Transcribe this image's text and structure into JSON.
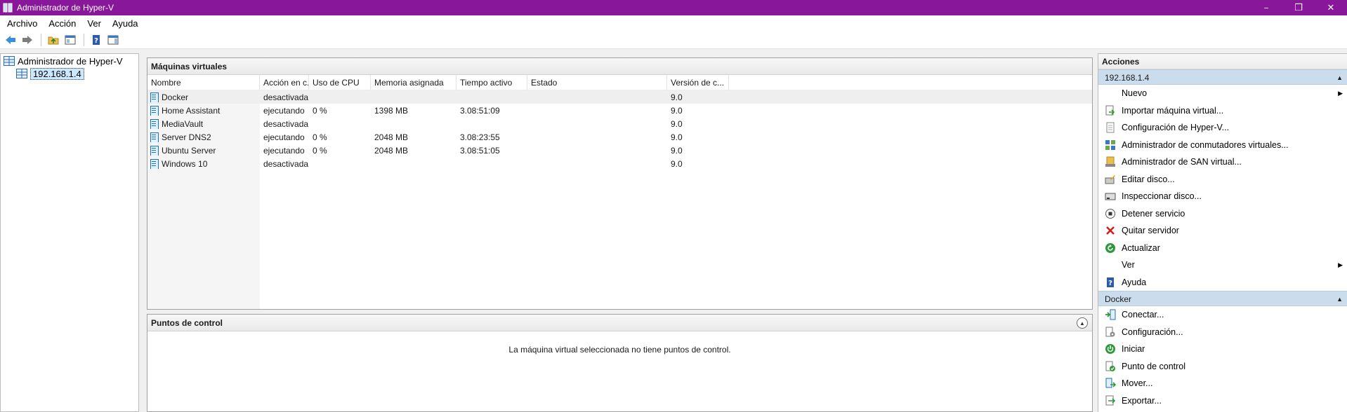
{
  "window": {
    "title": "Administrador de Hyper-V"
  },
  "menu": [
    "Archivo",
    "Acción",
    "Ver",
    "Ayuda"
  ],
  "tree": {
    "root": "Administrador de Hyper-V",
    "server": "192.168.1.4"
  },
  "vm_panel": {
    "title": "Máquinas virtuales",
    "columns": [
      "Nombre",
      "Acción en c...",
      "Uso de CPU",
      "Memoria asignada",
      "Tiempo activo",
      "Estado",
      "Versión de c..."
    ],
    "rows": [
      {
        "name": "Docker",
        "state": "desactivada",
        "cpu": "",
        "memory": "",
        "uptime": "",
        "status": "",
        "version": "9.0"
      },
      {
        "name": "Home Assistant",
        "state": "ejecutando",
        "cpu": "0 %",
        "memory": "1398 MB",
        "uptime": "3.08:51:09",
        "status": "",
        "version": "9.0"
      },
      {
        "name": "MediaVault",
        "state": "desactivada",
        "cpu": "",
        "memory": "",
        "uptime": "",
        "status": "",
        "version": "9.0"
      },
      {
        "name": "Server DNS2",
        "state": "ejecutando",
        "cpu": "0 %",
        "memory": "2048 MB",
        "uptime": "3.08:23:55",
        "status": "",
        "version": "9.0"
      },
      {
        "name": "Ubuntu Server",
        "state": "ejecutando",
        "cpu": "0 %",
        "memory": "2048 MB",
        "uptime": "3.08:51:05",
        "status": "",
        "version": "9.0"
      },
      {
        "name": "Windows 10",
        "state": "desactivada",
        "cpu": "",
        "memory": "",
        "uptime": "",
        "status": "",
        "version": "9.0"
      }
    ]
  },
  "checkpoints": {
    "title": "Puntos de control",
    "empty_message": "La máquina virtual seleccionada no tiene puntos de control."
  },
  "actions": {
    "title": "Acciones",
    "server_group": "192.168.1.4",
    "server_items": [
      {
        "label": "Nuevo",
        "icon": "none",
        "submenu": true
      },
      {
        "label": "Importar máquina virtual...",
        "icon": "import-vm-icon"
      },
      {
        "label": "Configuración de Hyper-V...",
        "icon": "settings-page-icon"
      },
      {
        "label": "Administrador de conmutadores virtuales...",
        "icon": "switch-manager-icon"
      },
      {
        "label": "Administrador de SAN virtual...",
        "icon": "san-icon"
      },
      {
        "label": "Editar disco...",
        "icon": "edit-disk-icon"
      },
      {
        "label": "Inspeccionar disco...",
        "icon": "inspect-disk-icon"
      },
      {
        "label": "Detener servicio",
        "icon": "stop-icon"
      },
      {
        "label": "Quitar servidor",
        "icon": "remove-x-icon"
      },
      {
        "label": "Actualizar",
        "icon": "refresh-icon"
      },
      {
        "label": "Ver",
        "icon": "none",
        "submenu": true
      },
      {
        "label": "Ayuda",
        "icon": "help-icon"
      }
    ],
    "vm_group": "Docker",
    "vm_items": [
      {
        "label": "Conectar...",
        "icon": "connect-icon"
      },
      {
        "label": "Configuración...",
        "icon": "vm-settings-icon"
      },
      {
        "label": "Iniciar",
        "icon": "power-icon"
      },
      {
        "label": "Punto de control",
        "icon": "checkpoint-icon"
      },
      {
        "label": "Mover...",
        "icon": "move-icon"
      },
      {
        "label": "Exportar...",
        "icon": "export-icon"
      }
    ]
  },
  "colors": {
    "titlebar": "#88179a",
    "action_group": "#cbdcec",
    "remove_red": "#d0201c",
    "refresh_green": "#2c9a3a"
  }
}
